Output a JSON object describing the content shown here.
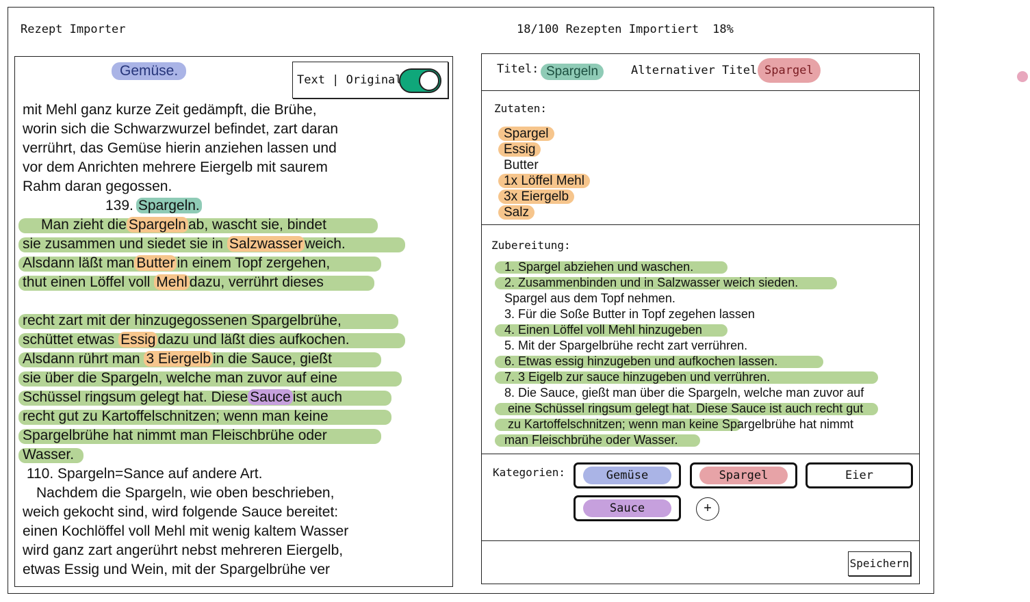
{
  "app": {
    "title": "Rezept Importer",
    "progress_text": "18/100 Rezepten Importiert",
    "progress_percent": "18%"
  },
  "source": {
    "category_badge": "Gemüse.",
    "toggle_label": "Text | Original",
    "toggle_on": true,
    "lines": [
      "mit Mehl ganz kurze Zeit gedämpft, die Brühe,",
      "worin sich die Schwarzwurzel befindet, zart daran",
      "verrührt, das Gemüse hierin anziehen lassen und",
      "vor dem Anrichten mehrere Eiergelb mit saurem",
      "Rahm daran gegossen.",
      "139.",
      "Spargeln.",
      "Man zieht die",
      "Spargeln",
      "ab, wascht sie, bindet",
      "sie zusammen und siedet sie in",
      "Salzwasser",
      "weich.",
      "Alsdann läßt man",
      "Butter",
      "in einem Topf zergehen,",
      "thut einen Löffel voll",
      "Mehl",
      "dazu, verrührt dieses",
      "recht zart mit der hinzugegossenen Spargelbrühe,",
      "schüttet etwas",
      "Essig",
      "dazu und läßt dies aufkochen.",
      "Alsdann rührt man",
      "3 Eiergelb",
      "in die Sauce, gießt",
      "sie über die Spargeln, welche man zuvor auf eine",
      "Schüssel ringsum gelegt hat. Diese",
      "Sauce",
      "ist auch",
      "recht gut zu Kartoffelschnitzen; wenn man keine",
      "Spargelbrühe hat nimmt man Fleischbrühe oder",
      "Wasser.",
      " 110. Spargeln=Sance auf andere Art.",
      "Nachdem die Spargeln, wie oben beschrieben,",
      "weich gekocht sind, wird folgende Sauce bereitet:",
      "einen Kochlöffel voll Mehl mit wenig kaltem Wasser",
      "wird ganz zart angerührt nebst mehreren Eiergelb,",
      "etwas Essig und Wein, mit der Spargelbrühe ver"
    ]
  },
  "recipe": {
    "title_label": "Titel:",
    "title_value": "Spargeln",
    "alt_title_label": "Alternativer Titel:",
    "alt_title_value": "Spargel",
    "ingredients_label": "Zutaten:",
    "ingredients": [
      "Spargel",
      "Essig",
      "Butter",
      "1x Löffel Mehl",
      "3x Eiergelb",
      "Salz"
    ],
    "preparation_label": "Zubereitung:",
    "preparation": [
      "1. Spargel abziehen und waschen.",
      "2. Zusammenbinden und in Salzwasser weich sieden.",
      "Spargel aus dem Topf nehmen.",
      "3. Für die Soße Butter in Topf zegehen lassen",
      "4. Einen Löffel voll Mehl hinzugeben",
      "5. Mit der Spargelbrühe recht zart verrühren.",
      "6. Etwas essig hinzugeben und aufkochen lassen.",
      "7. 3 Eigelb zur sauce hinzugeben und verrühren.",
      "8. Die Sauce, gießt man über die Spargeln, welche man zuvor auf",
      " eine Schüssel ringsum gelegt hat. Diese Sauce ist auch recht gut",
      " zu Kartoffelschnitzen; wenn man keine Spargelbrühe hat nimmt",
      "man Fleischbrühe oder Wasser."
    ],
    "categories_label": "Kategorien:",
    "categories": [
      "Gemüse",
      "Spargel",
      "Eier",
      "Sauce"
    ],
    "add_category": "+",
    "save_label": "Speichern"
  },
  "colors": {
    "ingredient_highlight": "#f6c58c",
    "text_highlight": "#a8cc85",
    "title_highlight": "#8fcbb6",
    "alt_title_highlight": "#e7a3a7",
    "category_gemuese": "#aab4e6",
    "category_spargel": "#e7a3a7",
    "category_sauce": "#c6a0dd",
    "toggle_on": "#0fa77a"
  }
}
